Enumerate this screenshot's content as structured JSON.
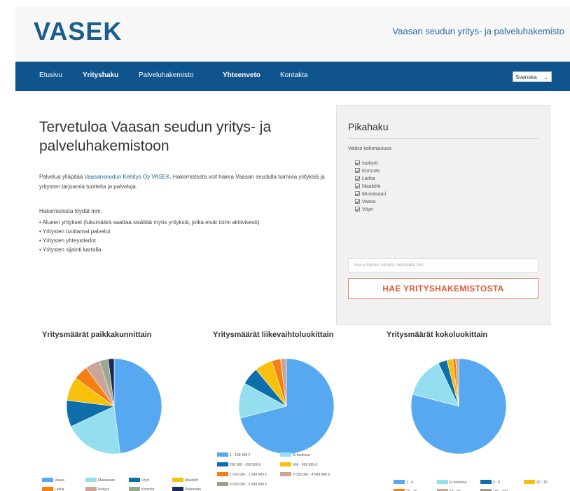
{
  "header": {
    "logo": "VASEK",
    "tagline": "Vaasan seudun yritys- ja palveluhakemisto"
  },
  "nav": {
    "items": [
      "Etusivu",
      "Yrityshaku",
      "Palveluhakemisto",
      "Yhteenveto",
      "Kontakta"
    ],
    "language": "Svenska"
  },
  "main": {
    "title": "Tervetuloa Vaasan seudun yritys- ja palveluhakemistoon",
    "intro_before": "Palvelua ylläpitää ",
    "intro_link": "Vaasanseudun Kehitys Oy VASEK",
    "intro_after": ". Hakemistosta voit hakea Vaasan seudulla toimivia yrityksiä ja yritysten tarjoamia tuotteita ja palveluja.",
    "list_title": "Hakemistosta löydät mm:",
    "list": [
      "• Alueen yritykset (lukumäärä saattaa sisältää myös yrityksiä, jotka eivät toimi aktiivisesti)",
      "• Yritysten tuottamat palvelut",
      "• Yritysten yhteystiedot",
      "• Yritysten sijainti kartalla"
    ]
  },
  "quick_search": {
    "title": "Pikahaku",
    "subtitle": "Valitse kokonaisuus:",
    "places": [
      "Isokyrö",
      "Korsnäs",
      "Laihia",
      "Maalahti",
      "Mustasaari",
      "Vaasa",
      "Vöyri"
    ],
    "input_placeholder": "Hae yrityksen nimellä, toimialalla tms.",
    "button": "HAE YRITYSHAKEMISTOSTA"
  },
  "colors": {
    "brand": "#1a5d8f",
    "nav": "#10548d",
    "button_text": "#e05a35"
  },
  "chart_data": [
    {
      "type": "pie",
      "title": "Yritysmäärät paikkakunnittain",
      "categories": [
        "Vaasa",
        "Mustasaari",
        "Vöyri",
        "Maalahti",
        "Laihia",
        "Isokyrö",
        "Korsnäs",
        "Pedersöre"
      ],
      "values": [
        48,
        20,
        9,
        8,
        5,
        5,
        3,
        2
      ],
      "colors": [
        "#56a8f0",
        "#93dff0",
        "#0d6ea9",
        "#f7c00b",
        "#f57f12",
        "#c9a59a",
        "#9aaa8e",
        "#1c2958"
      ],
      "legend_labels": [
        "Vaasa",
        "Mustasaari",
        "Vöyri",
        "Maalahti",
        "Laihia",
        "Isokyrö",
        "Korsnäs",
        "Pedersöre"
      ],
      "legend": "bottom"
    },
    {
      "type": "pie",
      "title": "Yritysmäärät liikevaihtoluokittain",
      "categories": [
        "1 - 199 999 €",
        "Ei tiedossa",
        "200 000 - 399 999 €",
        "400 - 999 999 €",
        "1 000 000 - 1 999 999 €",
        "2 000 000 - 4 999 999 €"
      ],
      "values": [
        71,
        12,
        6,
        6,
        3,
        2
      ],
      "colors": [
        "#56a8f0",
        "#93dff0",
        "#0d6ea9",
        "#f7c00b",
        "#f57f12",
        "#c9a59a"
      ],
      "legend_labels": [
        "1 - 199 999 €",
        "Ei tiedossa",
        "200 000 - 399 999 €",
        "400 - 999 999 €",
        "1 000 000 - 1 999 999 €",
        "2 000 000 - 4 999 999 €",
        "5 000 000 - 9 999 999 €"
      ],
      "legend": "bottom"
    },
    {
      "type": "pie",
      "title": "Yritysmäärät kokoluokittain",
      "categories": [
        "1 - 4",
        "Ei tiedossa",
        "5 - 9",
        "10 - 19",
        "20 - 49",
        "50 - 99"
      ],
      "values": [
        79,
        14,
        3,
        2,
        1,
        1
      ],
      "colors": [
        "#56a8f0",
        "#93dff0",
        "#0d6ea9",
        "#f7c00b",
        "#f57f12",
        "#c9a59a"
      ],
      "legend_labels": [
        "1 - 4",
        "Ei tiedossa",
        "5 - 9",
        "10 - 19",
        "20 - 49",
        "50 - 99",
        "100 - 249"
      ],
      "legend": "bottom"
    }
  ]
}
